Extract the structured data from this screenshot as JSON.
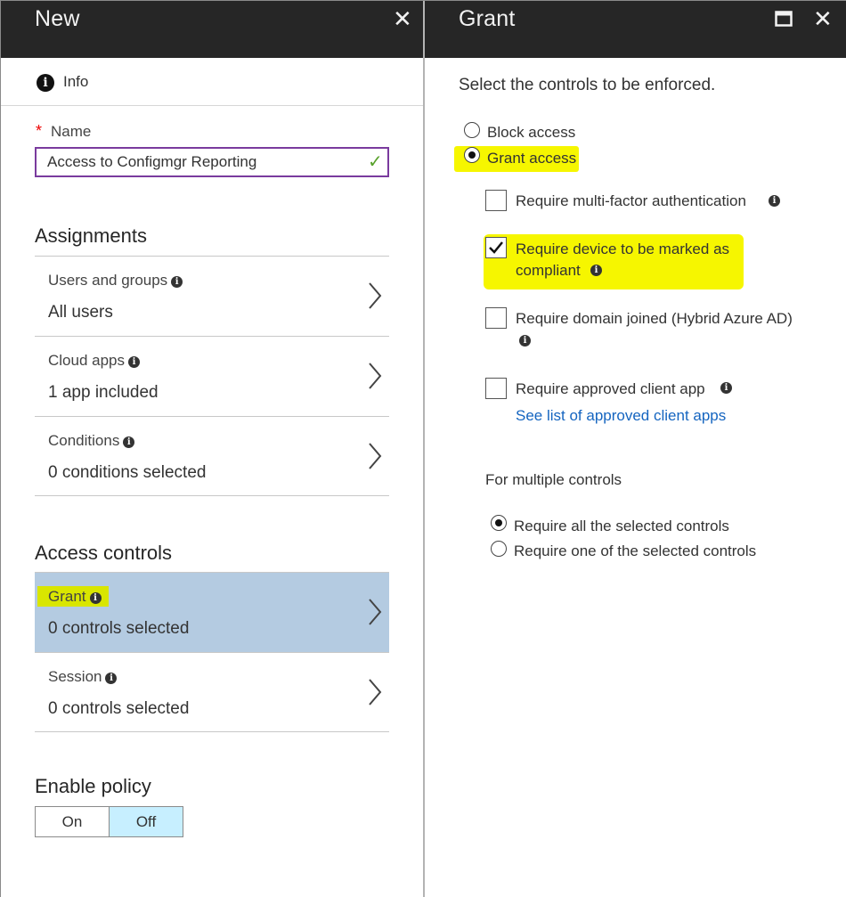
{
  "left_blade": {
    "title": "New",
    "close_glyph": "✕",
    "info_label": "Info",
    "info_icon": "i",
    "name_label": "Name",
    "required_marker": "*",
    "name_value": "Access to Configmgr Reporting",
    "valid_glyph": "✓",
    "assignments_title": "Assignments",
    "access_controls_title": "Access controls",
    "enable_policy_title": "Enable policy",
    "nav": {
      "users": {
        "title": "Users and groups",
        "value": "All users"
      },
      "cloud": {
        "title": "Cloud apps",
        "value": "1 app included"
      },
      "conditions": {
        "title": "Conditions",
        "value": "0 conditions selected"
      },
      "grant": {
        "title": "Grant",
        "value": "0 controls selected"
      },
      "session": {
        "title": "Session",
        "value": "0 controls selected"
      }
    },
    "info_glyph": "i",
    "toggle": {
      "on": "On",
      "off": "Off",
      "selected": "Off"
    }
  },
  "right_blade": {
    "title": "Grant",
    "maximize_glyph": "□",
    "close_glyph": "✕",
    "instruction": "Select the controls to be enforced.",
    "access": {
      "block": "Block access",
      "grant": "Grant access",
      "selected": "grant"
    },
    "controls": {
      "mfa": {
        "label": "Require multi-factor authentication",
        "checked": false
      },
      "compliant": {
        "label_line1": "Require device to be marked as",
        "label_line2": "compliant",
        "checked": true
      },
      "domain": {
        "label": "Require domain joined (Hybrid Azure AD)",
        "checked": false
      },
      "client_app": {
        "label": "Require approved client app",
        "checked": false,
        "link": "See list of approved client apps"
      }
    },
    "multiple_title": "For multiple controls",
    "multiple": {
      "all": "Require all the selected controls",
      "one": "Require one of the selected controls",
      "selected": "all"
    }
  },
  "colors": {
    "header_bg": "#262626",
    "selected_nav": "#b4cbe1",
    "highlight_yellow": "#f6f600",
    "highlight_grant": "#d9e600",
    "input_border": "#7a3b9e",
    "valid_green": "#58a12b",
    "link_blue": "#1565c0",
    "toggle_selected": "#c7efff"
  }
}
